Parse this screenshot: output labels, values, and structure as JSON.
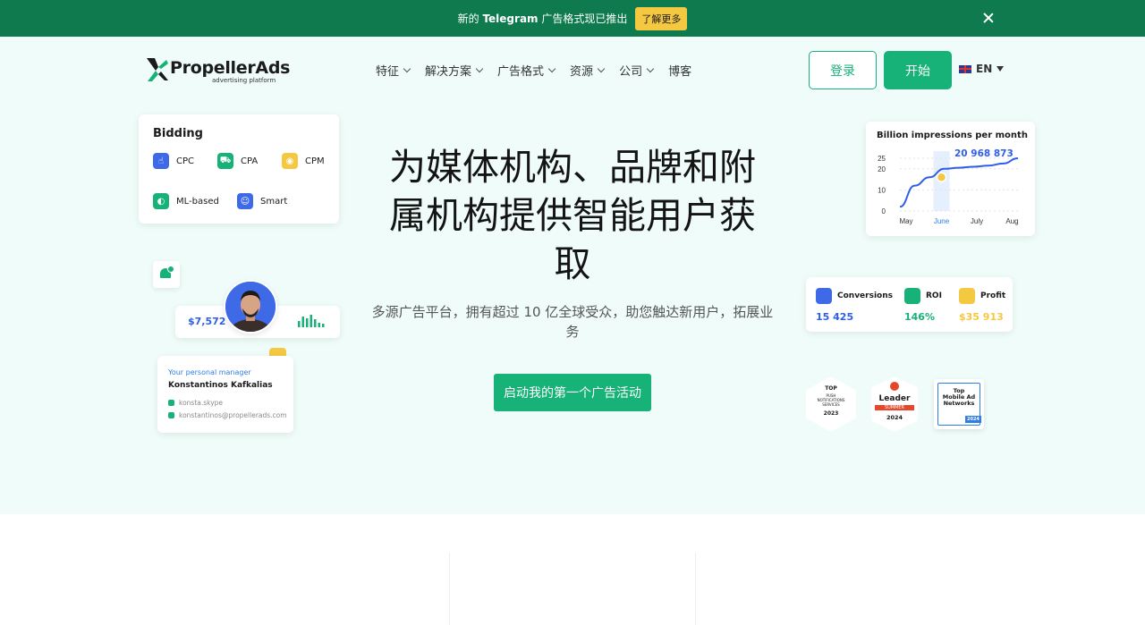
{
  "announcement": {
    "text_prefix": "新的 ",
    "text_bold": "Telegram",
    "text_suffix": " 广告格式现已推出",
    "button_label": "了解更多"
  },
  "header": {
    "logo_name": "PropellerAds",
    "logo_tagline": "advertising platform",
    "nav": [
      "特征",
      "解决方案",
      "广告格式",
      "资源",
      "公司",
      "博客"
    ],
    "login_label": "登录",
    "start_label": "开始",
    "language": "EN"
  },
  "hero": {
    "headline": "为媒体机构、品牌和附属机构提供智能用户获取",
    "subtitle": "多源广告平台，拥有超过 10 亿全球受众，助您触达新用户，拓展业务",
    "cta_label": "启动我的第一个广告活动"
  },
  "bidding": {
    "title": "Bidding",
    "items": [
      "CPC",
      "CPA",
      "CPM",
      "ML-based",
      "Smart"
    ]
  },
  "earnings": {
    "value": "$7,572"
  },
  "manager": {
    "role": "Your personal manager",
    "name": "Konstantinos Kafkalias",
    "skype": "konsta.skype",
    "email": "konstantinos@propellerads.com"
  },
  "impressions": {
    "title": "Billion impressions per month",
    "highlight_value": "20 968 873"
  },
  "metrics": [
    {
      "label": "Conversions",
      "value": "15 425",
      "color": "#2f5ee8"
    },
    {
      "label": "ROI",
      "value": "146%",
      "color": "#17b277"
    },
    {
      "label": "Profit",
      "value": "$35 913",
      "color": "#f5c842"
    }
  ],
  "awards": {
    "a1_top": "TOP",
    "a1_mid": "PUSH NOTIFICATIONS SERVICES",
    "a1_year": "2023",
    "a2_main": "Leader",
    "a2_season": "SUMMER",
    "a2_year": "2024",
    "a3_line1": "Top",
    "a3_line2": "Mobile Ad",
    "a3_line3": "Networks",
    "a3_year": "2024"
  },
  "chart_data": {
    "type": "line",
    "title": "Billion impressions per month",
    "categories": [
      "May",
      "June",
      "July",
      "Aug"
    ],
    "highlight_category": "June",
    "yticks": [
      0,
      10,
      20,
      25
    ],
    "ylim": [
      0,
      25
    ],
    "series": [
      {
        "values": [
          2,
          12,
          16,
          20,
          20.5,
          21,
          21.5,
          22.5,
          25
        ]
      }
    ],
    "colors": {
      "line": "#2f5ee8",
      "highlight": "#f5c842",
      "tick_highlight": "#2f7de8"
    }
  }
}
